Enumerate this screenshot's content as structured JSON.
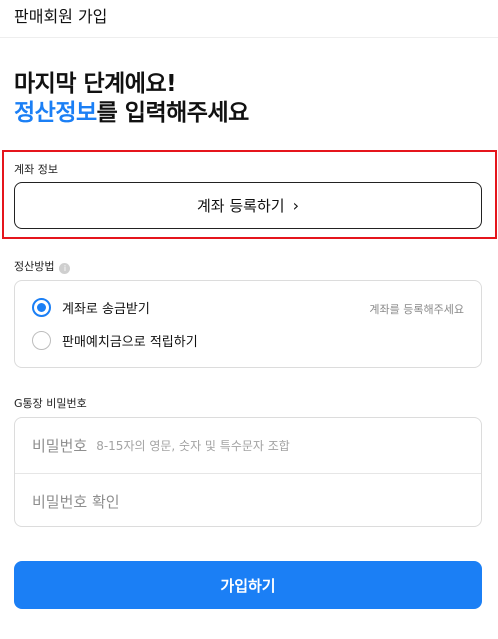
{
  "header": {
    "title": "판매회원 가입"
  },
  "headline": {
    "line1": "마지막 단계에요!",
    "accent": "정산정보",
    "line2_rest": "를 입력해주세요"
  },
  "account": {
    "label": "계좌 정보",
    "button_label": "계좌 등록하기",
    "chevron": "›"
  },
  "settlement": {
    "label": "정산방법",
    "info_icon": "i",
    "options": [
      {
        "label": "계좌로 송금받기",
        "checked": true,
        "hint": "계좌를 등록해주세요"
      },
      {
        "label": "판매예치금으로 적립하기",
        "checked": false
      }
    ]
  },
  "password": {
    "label": "G통장 비밀번호",
    "field1_label": "비밀번호",
    "field1_hint": "8-15자의 영문, 숫자 및 특수문자 조합",
    "field2_label": "비밀번호 확인"
  },
  "submit": {
    "label": "가입하기"
  },
  "colors": {
    "accent": "#1b7ff5",
    "highlight": "#e5151c"
  }
}
